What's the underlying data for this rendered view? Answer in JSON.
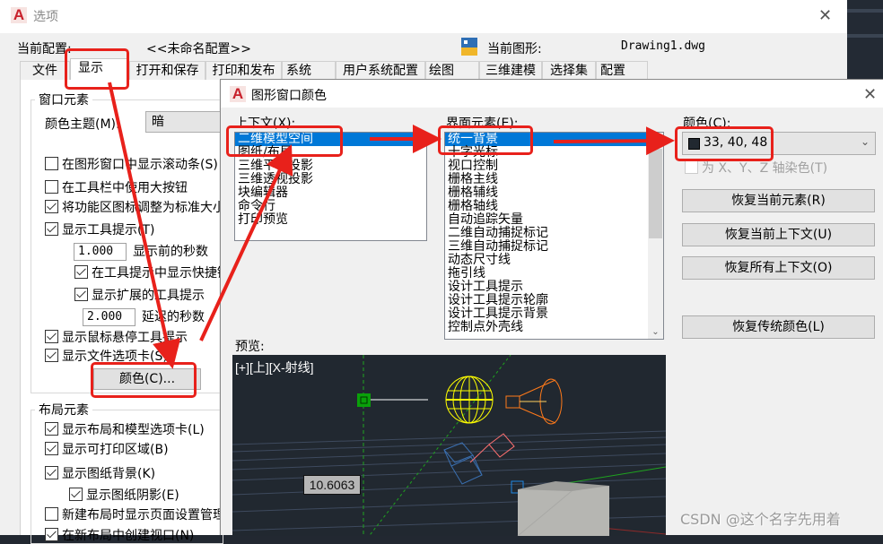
{
  "options_window": {
    "title": "选项",
    "current_profile_label": "当前配置:",
    "current_profile_value": "<<未命名配置>>",
    "current_drawing_label": "当前图形:",
    "current_drawing_value": "Drawing1.dwg",
    "tabs": [
      {
        "label": "文件",
        "active": false
      },
      {
        "label": "显示",
        "active": true
      },
      {
        "label": "打开和保存",
        "active": false
      },
      {
        "label": "打印和发布",
        "active": false
      },
      {
        "label": "系统",
        "active": false
      },
      {
        "label": "用户系统配置",
        "active": false
      },
      {
        "label": "绘图",
        "active": false
      },
      {
        "label": "三维建模",
        "active": false
      },
      {
        "label": "选择集",
        "active": false
      },
      {
        "label": "配置",
        "active": false
      }
    ],
    "window_elements": {
      "group_label": "窗口元素",
      "color_theme_label": "颜色主题(M):",
      "color_theme_value": "暗",
      "checkboxes": [
        {
          "label": "在图形窗口中显示滚动条(S)",
          "checked": false
        },
        {
          "label": "在工具栏中使用大按钮",
          "checked": false
        },
        {
          "label": "将功能区图标调整为标准大小",
          "checked": true
        },
        {
          "label": "显示工具提示(T)",
          "checked": true
        }
      ],
      "tooltip_delay_value": "1.000",
      "tooltip_delay_label": "显示前的秒数",
      "show_shortcut_label": "在工具提示中显示快捷键",
      "show_shortcut_checked": true,
      "show_extended_label": "显示扩展的工具提示",
      "show_extended_checked": true,
      "extended_delay_value": "2.000",
      "extended_delay_label": "延迟的秒数",
      "rollover_label": "显示鼠标悬停工具提示",
      "rollover_checked": true,
      "file_tabs_label": "显示文件选项卡(S)",
      "file_tabs_checked": true,
      "colors_button": "颜色(C)..."
    },
    "layout_elements": {
      "group_label": "布局元素",
      "checkboxes": [
        {
          "label": "显示布局和模型选项卡(L)",
          "checked": true
        },
        {
          "label": "显示可打印区域(B)",
          "checked": true
        },
        {
          "label": "显示图纸背景(K)",
          "checked": true
        }
      ],
      "paper_shadow_label": "显示图纸阴影(E)",
      "paper_shadow_checked": true,
      "page_setup_label": "新建布局时显示页面设置管理器",
      "page_setup_checked": false,
      "create_viewport_label": "在新布局中创建视口(N)",
      "create_viewport_checked": true
    }
  },
  "color_dialog": {
    "title": "图形窗口颜色",
    "context_label": "上下文(X):",
    "contexts": [
      "二维模型空间",
      "图纸/布局",
      "三维平行投影",
      "三维透视投影",
      "块编辑器",
      "命令行",
      "打印预览"
    ],
    "selected_context": "二维模型空间",
    "interface_element_label": "界面元素(E):",
    "interface_elements": [
      "统一背景",
      "十字光标",
      "视口控制",
      "栅格主线",
      "栅格辅线",
      "栅格轴线",
      "自动追踪矢量",
      "二维自动捕捉标记",
      "三维自动捕捉标记",
      "动态尺寸线",
      "拖引线",
      "设计工具提示",
      "设计工具提示轮廓",
      "设计工具提示背景",
      "控制点外壳线"
    ],
    "selected_element": "统一背景",
    "color_label": "颜色(C):",
    "color_value": "33, 40, 48",
    "color_hex": "#212830",
    "tint_axes_label": "为 X、Y、Z 轴染色(T)",
    "tint_axes_checked": false,
    "buttons": {
      "restore_element": "恢复当前元素(R)",
      "restore_context": "恢复当前上下文(U)",
      "restore_all": "恢复所有上下文(O)",
      "restore_classic": "恢复传统颜色(L)"
    },
    "preview_label": "预览:",
    "preview": {
      "viewport_label": "[+][上][X-射线]",
      "dimension_value": "10.6063"
    }
  },
  "annotation_color": "#e8211b",
  "watermark": "CSDN @这个名字先用着"
}
